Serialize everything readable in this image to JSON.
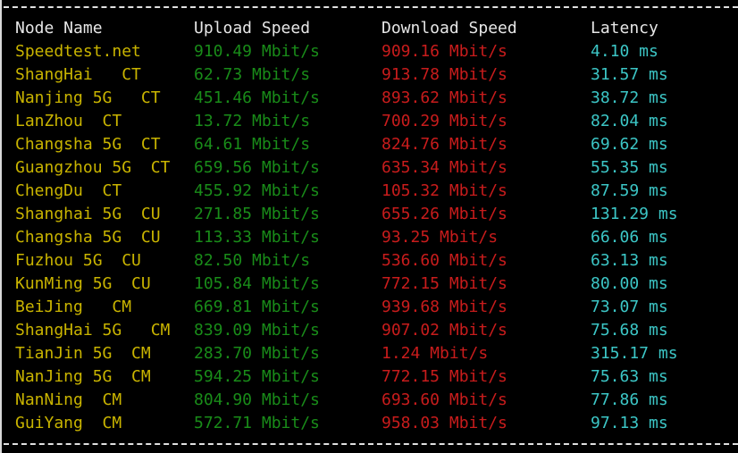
{
  "colors": {
    "node": "#c9b400",
    "upload": "#198c19",
    "download": "#c81c1c",
    "latency": "#3cc6c6",
    "header": "#e6e6e6"
  },
  "header": {
    "node": "Node Name",
    "upload": "Upload Speed",
    "download": "Download Speed",
    "latency": "Latency"
  },
  "rows": [
    {
      "node": "Speedtest.net",
      "upload": "910.49 Mbit/s",
      "download": "909.16 Mbit/s",
      "latency": "4.10 ms"
    },
    {
      "node": "ShangHai   CT",
      "upload": "62.73 Mbit/s",
      "download": "913.78 Mbit/s",
      "latency": "31.57 ms"
    },
    {
      "node": "Nanjing 5G   CT",
      "upload": "451.46 Mbit/s",
      "download": "893.62 Mbit/s",
      "latency": "38.72 ms"
    },
    {
      "node": "LanZhou  CT",
      "upload": "13.72 Mbit/s",
      "download": "700.29 Mbit/s",
      "latency": "82.04 ms"
    },
    {
      "node": "Changsha 5G  CT",
      "upload": "64.61 Mbit/s",
      "download": "824.76 Mbit/s",
      "latency": "69.62 ms"
    },
    {
      "node": "Guangzhou 5G  CT",
      "upload": "659.56 Mbit/s",
      "download": "635.34 Mbit/s",
      "latency": "55.35 ms"
    },
    {
      "node": "ChengDu  CT",
      "upload": "455.92 Mbit/s",
      "download": "105.32 Mbit/s",
      "latency": "87.59 ms"
    },
    {
      "node": "Shanghai 5G  CU",
      "upload": "271.85 Mbit/s",
      "download": "655.26 Mbit/s",
      "latency": "131.29 ms"
    },
    {
      "node": "Changsha 5G  CU",
      "upload": "113.33 Mbit/s",
      "download": "93.25 Mbit/s",
      "latency": "66.06 ms"
    },
    {
      "node": "Fuzhou 5G  CU",
      "upload": "82.50 Mbit/s",
      "download": "536.60 Mbit/s",
      "latency": "63.13 ms"
    },
    {
      "node": "KunMing 5G  CU",
      "upload": "105.84 Mbit/s",
      "download": "772.15 Mbit/s",
      "latency": "80.00 ms"
    },
    {
      "node": "BeiJing   CM",
      "upload": "669.81 Mbit/s",
      "download": "939.68 Mbit/s",
      "latency": "73.07 ms"
    },
    {
      "node": "ShangHai 5G   CM",
      "upload": "839.09 Mbit/s",
      "download": "907.02 Mbit/s",
      "latency": "75.68 ms"
    },
    {
      "node": "TianJin 5G  CM",
      "upload": "283.70 Mbit/s",
      "download": "1.24 Mbit/s",
      "latency": "315.17 ms"
    },
    {
      "node": "NanJing 5G  CM",
      "upload": "594.25 Mbit/s",
      "download": "772.15 Mbit/s",
      "latency": "75.63 ms"
    },
    {
      "node": "NanNing  CM",
      "upload": "804.90 Mbit/s",
      "download": "693.60 Mbit/s",
      "latency": "77.86 ms"
    },
    {
      "node": "GuiYang  CM",
      "upload": "572.71 Mbit/s",
      "download": "958.03 Mbit/s",
      "latency": "97.13 ms"
    }
  ]
}
